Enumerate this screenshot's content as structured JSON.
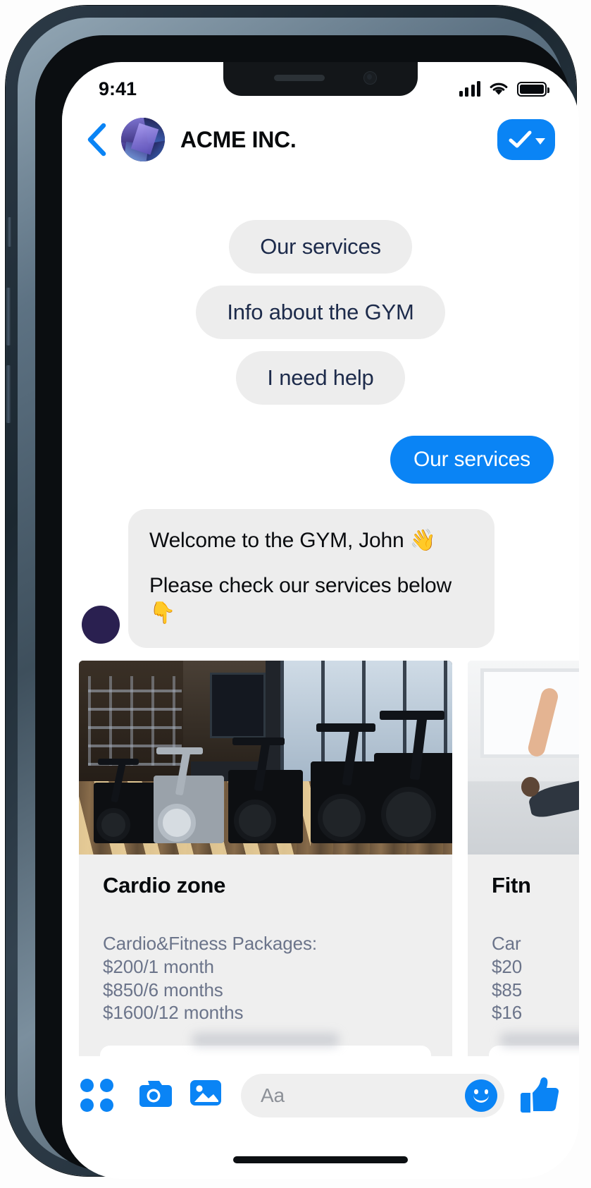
{
  "status_bar": {
    "time": "9:41",
    "cellular_icon": "signal-bars-icon",
    "wifi_icon": "wifi-icon",
    "battery_icon": "battery-full-icon"
  },
  "header": {
    "back_icon": "back-chevron-icon",
    "avatar_icon": "acme-avatar",
    "title": "ACME INC.",
    "action_icon": "checkmark-icon",
    "action_caret_icon": "caret-down-icon",
    "accent_color": "#0a84f5"
  },
  "quick_replies": [
    {
      "label": "Our services"
    },
    {
      "label": "Info about the GYM"
    },
    {
      "label": "I need help"
    }
  ],
  "messages": [
    {
      "direction": "outgoing",
      "text": "Our services"
    },
    {
      "direction": "incoming",
      "avatar_icon": "acme-avatar-small",
      "line1": "Welcome to the GYM,  John 👋",
      "line2": "Please check our services below 👇"
    }
  ],
  "cards": [
    {
      "image_icon": "cardio-gym-photo",
      "title": "Cardio zone",
      "details": [
        "Cardio&Fitness Packages:",
        "$200/1 month",
        "$850/6 months",
        "$1600/12 months"
      ],
      "button_label": ""
    },
    {
      "image_icon": "yoga-stretch-photo",
      "title": "Fitn",
      "details": [
        "Car",
        "$20",
        "$85",
        "$16"
      ],
      "button_label": ""
    }
  ],
  "toolbar": {
    "apps_icon": "four-dots-grid-icon",
    "camera_icon": "camera-icon",
    "gallery_icon": "photo-gallery-icon",
    "input_placeholder": "Aa",
    "emoji_icon": "smiley-face-icon",
    "like_icon": "thumbs-up-icon"
  },
  "colors": {
    "messenger_blue": "#0a84f5",
    "bubble_gray": "#ededed",
    "quick_reply_text": "#1d2b4b",
    "card_detail_text": "#6b748a"
  }
}
